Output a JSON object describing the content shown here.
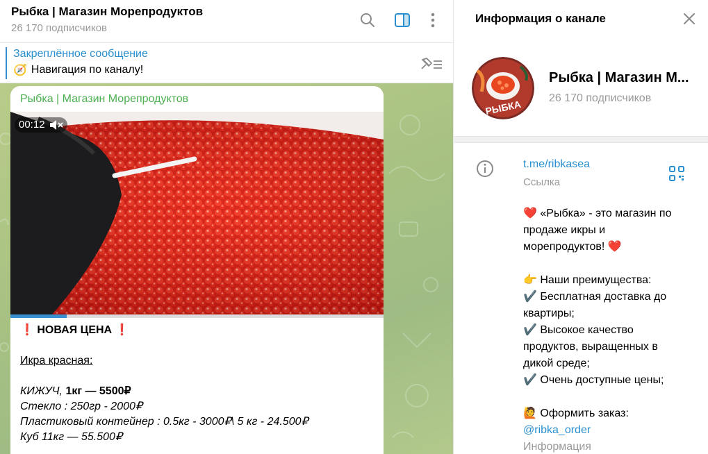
{
  "header": {
    "title": "Рыбка | Магазин Морепродуктов",
    "subscribers": "26 170 подписчиков",
    "icons": [
      "search-icon",
      "sidebar-toggle-icon",
      "more-vertical-icon"
    ]
  },
  "pinned": {
    "title": "Закреплённое сообщение",
    "emoji": "🧭",
    "text": "Навигация по каналу!"
  },
  "message": {
    "author": "Рыбка | Магазин Морепродуктов",
    "video_time": "00:12",
    "video_progress_fraction": 0.15,
    "lines": [
      {
        "text": "❗ НОВАЯ ЦЕНА ❗",
        "style": "bold"
      },
      {
        "text": "",
        "style": "blank"
      },
      {
        "text": "Икра красная:",
        "style": "underline"
      },
      {
        "text": "",
        "style": "blank"
      },
      {
        "text_italic": "КИЖУЧ, ",
        "text_bold": "1кг  — 5500₽",
        "style": "mixed"
      },
      {
        "text": "Стекло :  250гр - 2000₽",
        "style": "italic"
      },
      {
        "text": "Пластиковый контейнер : 0.5кг - 3000₽\\ 5 кг - 24.500₽",
        "style": "italic"
      },
      {
        "text": "Куб 11кг — 55.500₽",
        "style": "italic"
      }
    ]
  },
  "info_panel": {
    "title": "Информация о канале",
    "avatar_text": "РЫБКА",
    "channel_name": "Рыбка | Магазин М...",
    "subscribers": "26 170 подписчиков",
    "link": "t.me/ribkasea",
    "link_label": "Ссылка",
    "description_lines": [
      "❤️ «Рыбка» - это магазин по",
      "продаже икры и",
      "морепродуктов! ❤️",
      "",
      "👉 Наши преимущества:",
      "✔️ Бесплатная доставка до",
      "квартиры;",
      "✔️ Высокое качество",
      "продуктов, выращенных в",
      "дикой среде;",
      "✔️ Очень доступные цены;",
      "",
      "🙋 Оформить заказ:"
    ],
    "order_link": "@ribka_order",
    "description_label": "Информация"
  },
  "colors": {
    "accent": "#2a8fcf",
    "author": "#4caf50",
    "chat_background": "#a9c283",
    "caviar": "#e0201a"
  }
}
